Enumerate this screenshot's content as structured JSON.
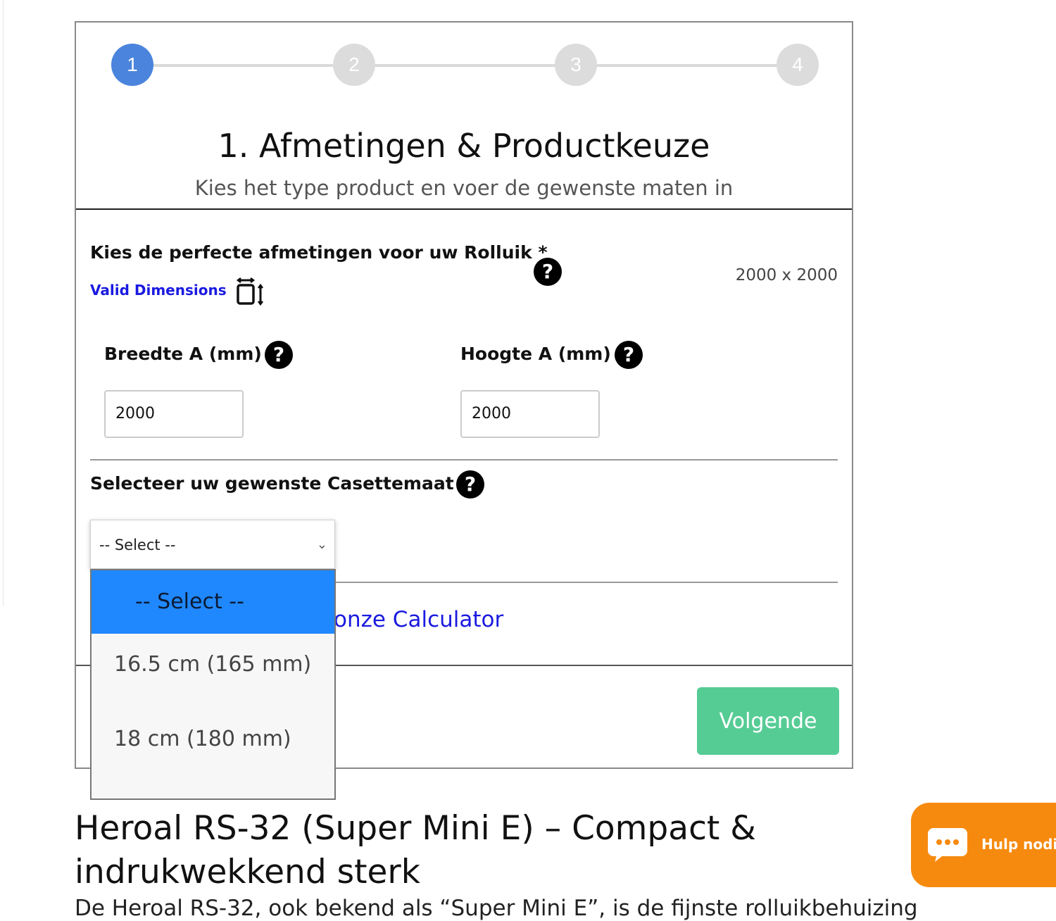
{
  "wizard": {
    "steps": [
      "1",
      "2",
      "3",
      "4"
    ],
    "active_step": 1,
    "title": "1. Afmetingen & Productkeuze",
    "subtitle": "Kies het type product en voer de gewenste maten in"
  },
  "dimensions": {
    "label": "Kies de perfecte afmetingen voor uw Rolluik *",
    "valid_link": "Valid Dimensions",
    "readout": "2000 x 2000",
    "width_label": "Breedte A (mm)",
    "width_value": "2000",
    "height_label": "Hoogte A (mm)",
    "height_value": "2000",
    "help_glyph": "?"
  },
  "cassette": {
    "label": "Selecteer uw gewenste Casettemaat *",
    "selected": "-- Select --",
    "options": [
      "-- Select --",
      "16.5 cm (165 mm)",
      "18 cm (180 mm)"
    ]
  },
  "calculator_link": "onze Calculator",
  "next_button": "Volgende",
  "product": {
    "title": "Heroal RS-32 (Super Mini E) – Compact & indrukwekkend sterk",
    "cutoff_text": "De Heroal RS-32, ook bekend als “Super Mini E”, is de fijnste rolluikbehuizing"
  },
  "chat": {
    "label": "Hulp nodig?"
  },
  "colors": {
    "active_step": "#4a84dc",
    "next_button": "#56cc95",
    "dropdown_highlight": "#2088ff",
    "chat_widget": "#f68a0f",
    "link": "#1a1ae0"
  },
  "icons": [
    "help-icon",
    "dimensions-icon",
    "chevron-down-icon",
    "chat-icon"
  ]
}
